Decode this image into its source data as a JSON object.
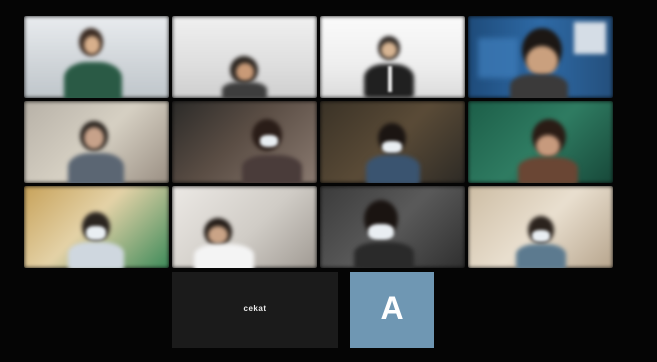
{
  "meeting": {
    "participants": [
      {
        "id": "p1"
      },
      {
        "id": "p2"
      },
      {
        "id": "p3"
      },
      {
        "id": "p4"
      },
      {
        "id": "p5"
      },
      {
        "id": "p6"
      },
      {
        "id": "p7"
      },
      {
        "id": "p8"
      },
      {
        "id": "p9"
      },
      {
        "id": "p10"
      },
      {
        "id": "p11"
      },
      {
        "id": "p12"
      }
    ],
    "bottom_row": {
      "name_tile": {
        "name": "cekat"
      },
      "avatar_tile": {
        "letter": "A"
      }
    }
  }
}
